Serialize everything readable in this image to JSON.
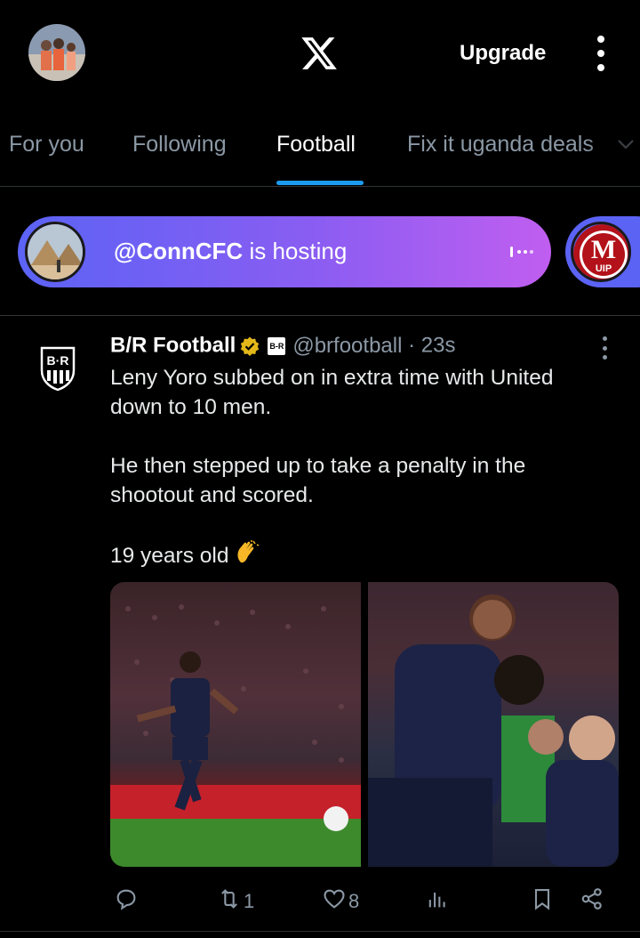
{
  "header": {
    "upgrade_label": "Upgrade"
  },
  "tabs": [
    {
      "label": "For you",
      "active": false
    },
    {
      "label": "Following",
      "active": false
    },
    {
      "label": "Football",
      "active": true
    },
    {
      "label": "Fix it uganda deals",
      "active": false
    }
  ],
  "space": {
    "host": "@ConnCFC",
    "status": " is hosting",
    "second_badge": "M",
    "second_badge_sub": "UIP"
  },
  "tweet": {
    "author": "B/R Football",
    "affiliate_badge": "B-R",
    "handle": "@brfootball",
    "separator": "·",
    "time": "23s",
    "logo_text": "B·R",
    "text_line_1": "Leny Yoro subbed on in extra time with United down to 10 men.",
    "text_line_2": "He then stepped up to take a penalty in the shootout and scored.",
    "text_line_3": "19 years old",
    "replies": "",
    "reposts": "1",
    "likes": "8",
    "views": ""
  },
  "colors": {
    "accent": "#1d9bf0",
    "background": "#000000",
    "muted": "#8b98a5",
    "verified_gold": "#e2b719",
    "space_gradient_start": "#5b63f5",
    "space_gradient_end": "#c05ef0"
  },
  "icons": {
    "logo": "x-logo-icon",
    "menu": "more-vertical-icon",
    "reply": "reply-icon",
    "repost": "repost-icon",
    "like": "heart-icon",
    "views": "views-icon",
    "bookmark": "bookmark-icon",
    "share": "share-icon"
  }
}
